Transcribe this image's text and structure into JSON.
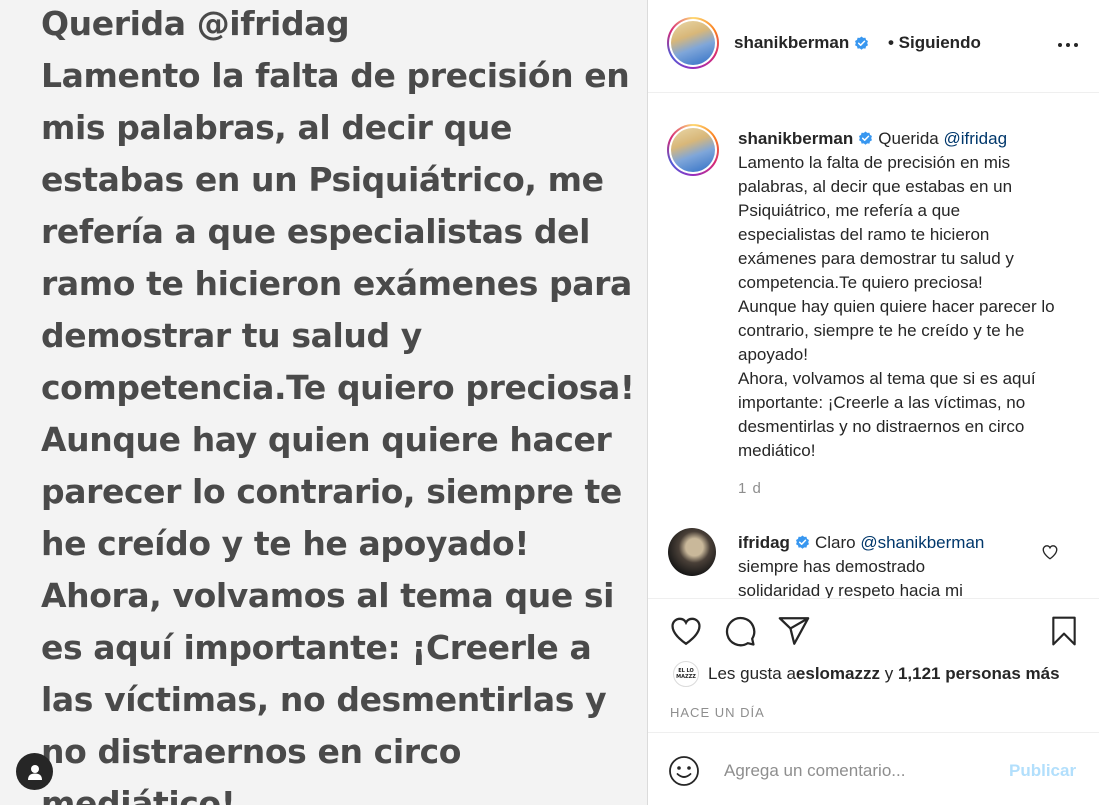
{
  "image_post": {
    "lines": [
      "Querida @ifridag",
      "Lamento la falta de precisión en",
      "mis palabras, al decir que",
      "estabas en un Psiquiátrico, me",
      "refería a que especialistas del",
      "ramo te hicieron exámenes para",
      "demostrar tu salud y",
      "competencia.Te quiero preciosa!",
      "Aunque hay  quien quiere hacer",
      "parecer lo contrario, siempre te",
      "he creído y te he apoyado!",
      "Ahora, volvamos al tema que si",
      "es aquí importante: ¡Creerle a",
      "las víctimas, no desmentirlas y",
      "no distraernos en circo",
      "mediático!"
    ]
  },
  "header": {
    "username": "shanikberman",
    "follow_status": "• Siguiendo"
  },
  "caption": {
    "username": "shanikberman",
    "prefix": "Querida ",
    "mention": "@ifridag",
    "body": "Lamento la falta de precisión en mis palabras, al decir que estabas en un Psiquiátrico, me refería a que especialistas del ramo te hicieron exámenes para demostrar tu salud y competencia.Te quiero preciosa!\nAunque hay quien quiere hacer parecer lo contrario, siempre te he creído y te he apoyado!\nAhora, volvamos al tema que si es aquí importante: ¡Creerle a las víctimas, no desmentirlas y no distraernos en circo mediático!",
    "time": "1 d"
  },
  "reply": {
    "username": "ifridag",
    "prefix": "Claro ",
    "mention": "@shanikberman",
    "body": "siempre has demostrado\nsolidaridad y respeto hacia mi"
  },
  "likes": {
    "liker_avatar_text": "EL LO MAZZZ",
    "prefix": "Les gusta a ",
    "liker": "eslomazzz",
    "middle": " y ",
    "count": "1,121 personas más"
  },
  "post_time": "HACE UN DÍA",
  "comment_box": {
    "placeholder": "Agrega un comentario...",
    "publish_label": "Publicar"
  },
  "icons": {
    "verified_color": "#3897f0",
    "accent_color": "#0095f6"
  }
}
